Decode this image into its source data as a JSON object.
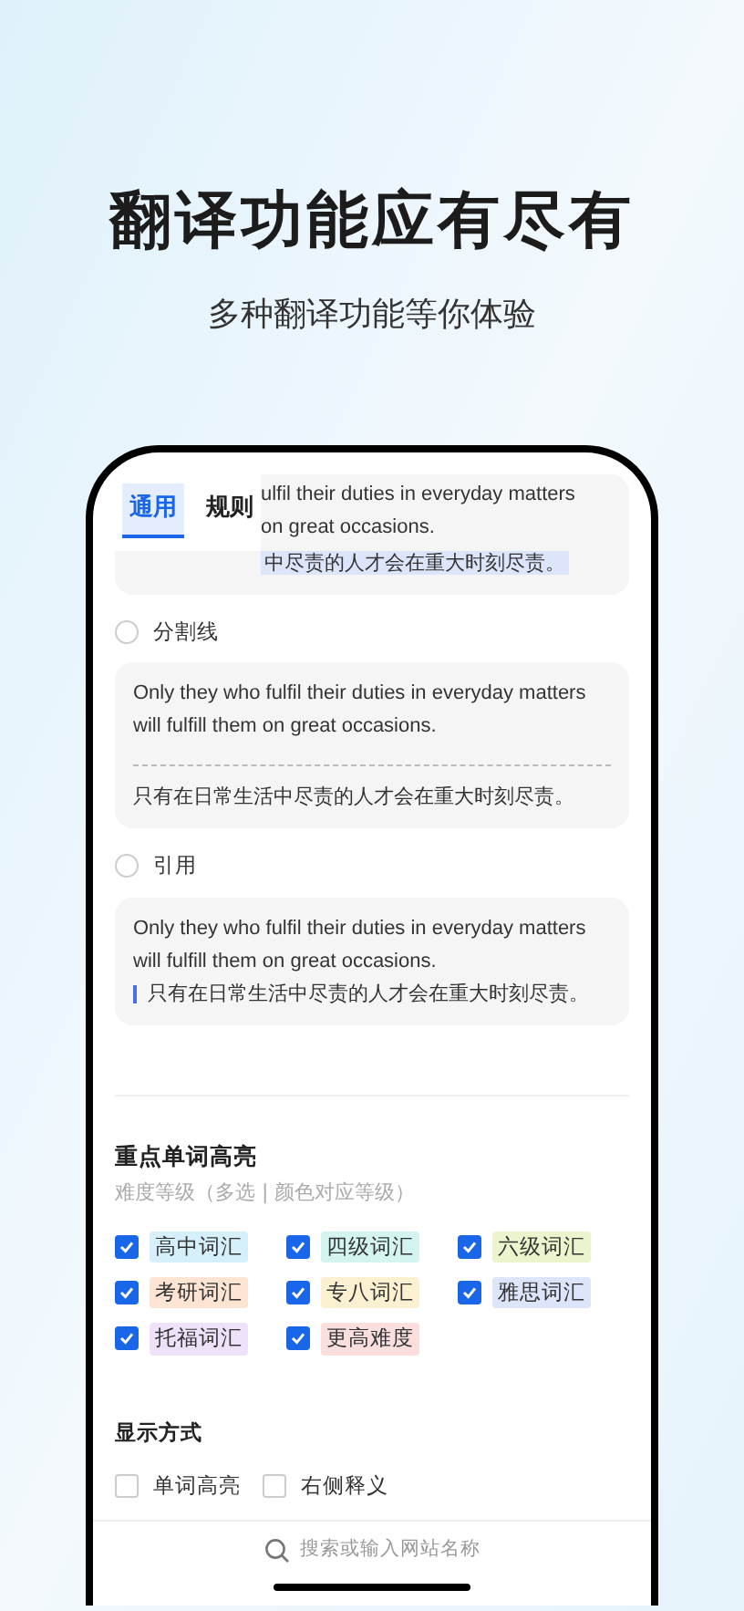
{
  "headline": "翻译功能应有尽有",
  "subheadline": "多种翻译功能等你体验",
  "tabs": [
    {
      "label": "通用",
      "selected": true
    },
    {
      "label": "规则",
      "selected": false
    }
  ],
  "preview_card": {
    "lines": [
      "ulfil their duties in everyday matters",
      "on great occasions."
    ],
    "translation": "中尽责的人才会在重大时刻尽责。"
  },
  "styles": [
    {
      "label": "分割线",
      "selected": false,
      "kind": "divider",
      "original": "Only they who fulfil their duties in everyday matters will fulfill them on great occasions.",
      "translation": "只有在日常生活中尽责的人才会在重大时刻尽责。"
    },
    {
      "label": "引用",
      "selected": false,
      "kind": "quote",
      "original": "Only they who fulfil their duties in everyday matters will fulfill them on great occasions.",
      "translation": "只有在日常生活中尽责的人才会在重大时刻尽责。"
    }
  ],
  "highlight": {
    "title": "重点单词高亮",
    "subtitle": "难度等级（多选 | 颜色对应等级）",
    "levels": [
      {
        "label": "高中词汇",
        "checked": true,
        "color": "#d6f0fb"
      },
      {
        "label": "四级词汇",
        "checked": true,
        "color": "#d3f4ef"
      },
      {
        "label": "六级词汇",
        "checked": true,
        "color": "#eaf5cd"
      },
      {
        "label": "考研词汇",
        "checked": true,
        "color": "#fde4d3"
      },
      {
        "label": "专八词汇",
        "checked": true,
        "color": "#fbf0d0"
      },
      {
        "label": "雅思词汇",
        "checked": true,
        "color": "#dde5fb"
      },
      {
        "label": "托福词汇",
        "checked": true,
        "color": "#eee2fb"
      },
      {
        "label": "更高难度",
        "checked": true,
        "color": "#fbdfdf"
      }
    ]
  },
  "display": {
    "title": "显示方式",
    "options": [
      {
        "label": "单词高亮",
        "checked": false
      },
      {
        "label": "右侧释义",
        "checked": false
      }
    ]
  },
  "search": {
    "placeholder": "搜索或输入网站名称"
  }
}
